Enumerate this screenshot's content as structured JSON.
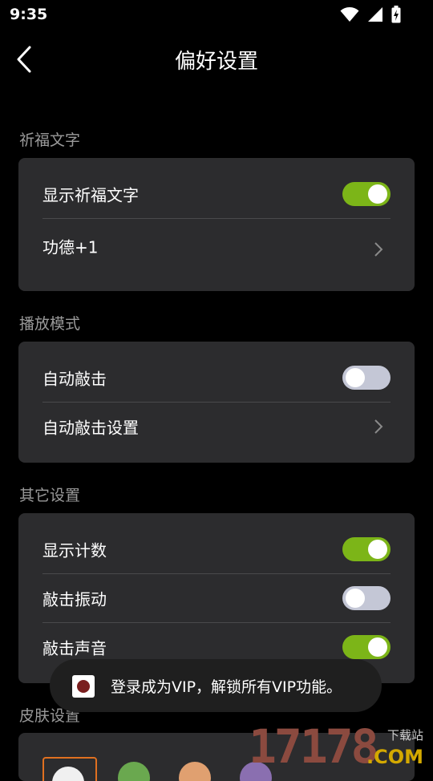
{
  "status_bar": {
    "time": "9:35",
    "icons": [
      "wifi-icon",
      "signal-icon",
      "battery-charging-icon"
    ]
  },
  "header": {
    "title": "偏好设置",
    "back_icon": "chevron-left-icon"
  },
  "sections": {
    "blessing": {
      "label": "祈福文字",
      "show_blessing": {
        "label": "显示祈福文字",
        "on": true
      },
      "merit": {
        "label": "功德+1"
      }
    },
    "play_mode": {
      "label": "播放模式",
      "auto_knock": {
        "label": "自动敲击",
        "on": false
      },
      "auto_knock_settings": {
        "label": "自动敲击设置"
      }
    },
    "other": {
      "label": "其它设置",
      "show_count": {
        "label": "显示计数",
        "on": true
      },
      "knock_vibrate": {
        "label": "敲击振动",
        "on": false
      },
      "knock_sound": {
        "label": "敲击声音",
        "on": true
      }
    },
    "skin": {
      "label": "皮肤设置"
    }
  },
  "toast": {
    "text": "登录成为VIP，解锁所有VIP功能。"
  },
  "watermark": {
    "number": "17178",
    "top": "下载站",
    "domain": ".COM"
  },
  "colors": {
    "toggle_on": "#7cb518",
    "toggle_off": "#c4c7d6",
    "card_bg": "#2c2c2e",
    "background": "#000000"
  }
}
